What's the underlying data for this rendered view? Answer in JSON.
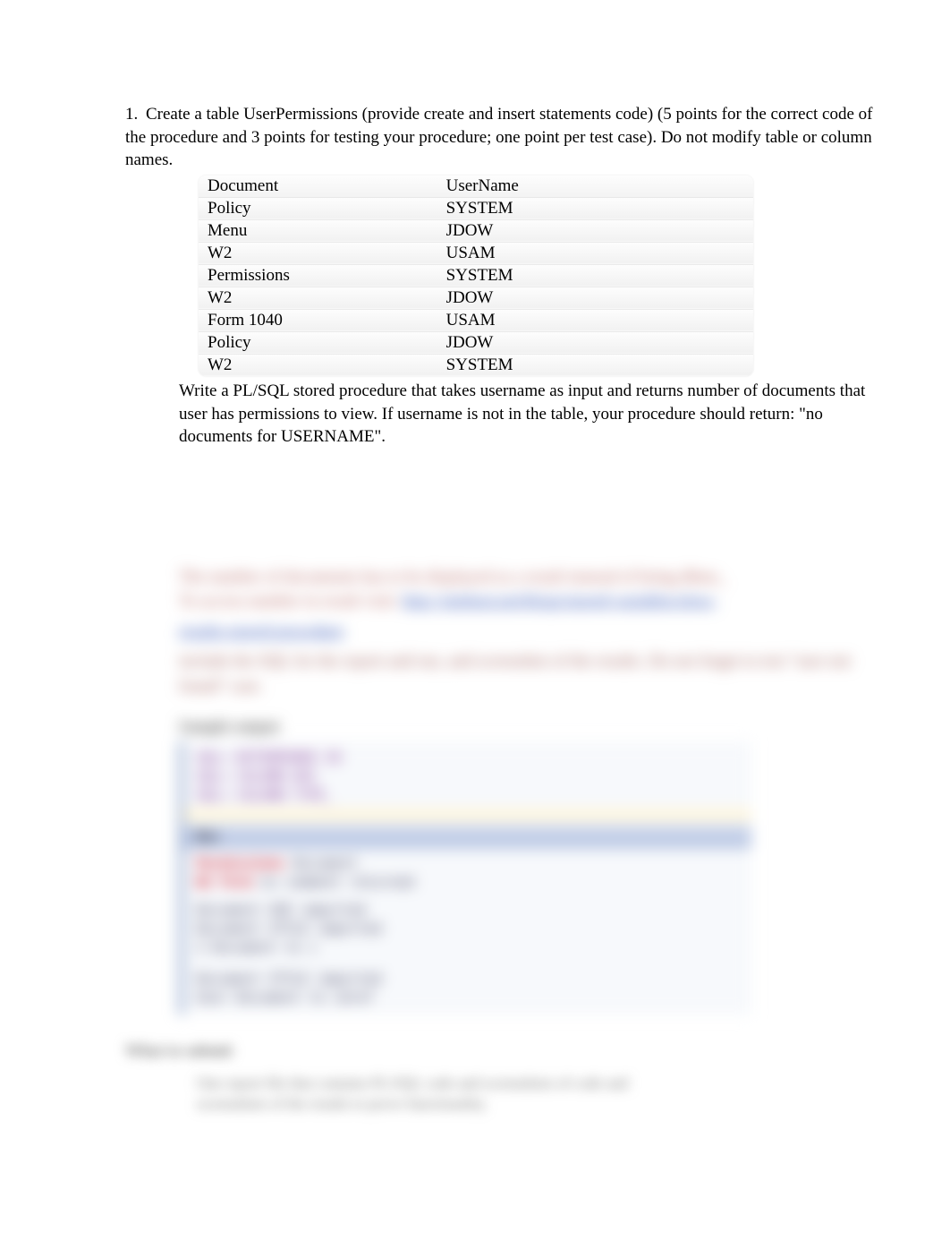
{
  "question": {
    "number": "1.",
    "intro": "Create a table UserPermissions (provide create and insert statements code) (5 points for the correct code of the procedure and 3 points for testing your procedure; one point per test case). Do not modify table or column names.",
    "table": {
      "headers": {
        "col1": "Document",
        "col2": "UserName"
      },
      "rows": [
        {
          "doc": "Policy",
          "user": "SYSTEM"
        },
        {
          "doc": "Menu",
          "user": "JDOW"
        },
        {
          "doc": "W2",
          "user": "USAM"
        },
        {
          "doc": "Permissions",
          "user": "SYSTEM"
        },
        {
          "doc": "W2",
          "user": "JDOW"
        },
        {
          "doc": "Form 1040",
          "user": "USAM"
        },
        {
          "doc": "Policy",
          "user": "JDOW"
        },
        {
          "doc": "W2",
          "user": "SYSTEM"
        }
      ]
    },
    "post": "Write a PL/SQL  stored procedure that takes username  as input and returns number of documents that user has permissions to view. If username  is not in the table, your procedure should return: \"no documents for USERNAME\"."
  },
  "blurred": {
    "p1a": "The number of documents has to be displayed as a result instead of being dbms_",
    "p1b": "To access number in result visit:",
    "link": "http://sitehost.net/blogs/stored-variables/slow-",
    "linkline2": "results-stored-procedure",
    "p2": "include  the SQL for the report and run, and screenshot of the results. Do not forget to test \"user not found\" case.",
    "sample_label": "Sample output",
    "code_l1": "SQL> DETERMINED ID",
    "code_l2": "SQL> COLUMN  DOC  ",
    "code_l3": "SQL> COLUMN  TYPE_",
    "code_hdr": "Doc",
    "code_r1a": "Permissions    ",
    "code_r1b": "Document",
    "code_r2a": "W2  Form  ",
    "code_r2b": "no comment returned",
    "code_r3": "Document   USE   imported",
    "code_r4": "Document  STYLE  imported",
    "code_r5": "2  Document  to  i",
    "code_r6": "Document STYLE imported",
    "code_r7": "User Document  to  idref",
    "what_label": "What to submit",
    "what_body": "One report file that contains PL/SQL code and screenshots of code and screenshots of the results to prove functionality."
  }
}
